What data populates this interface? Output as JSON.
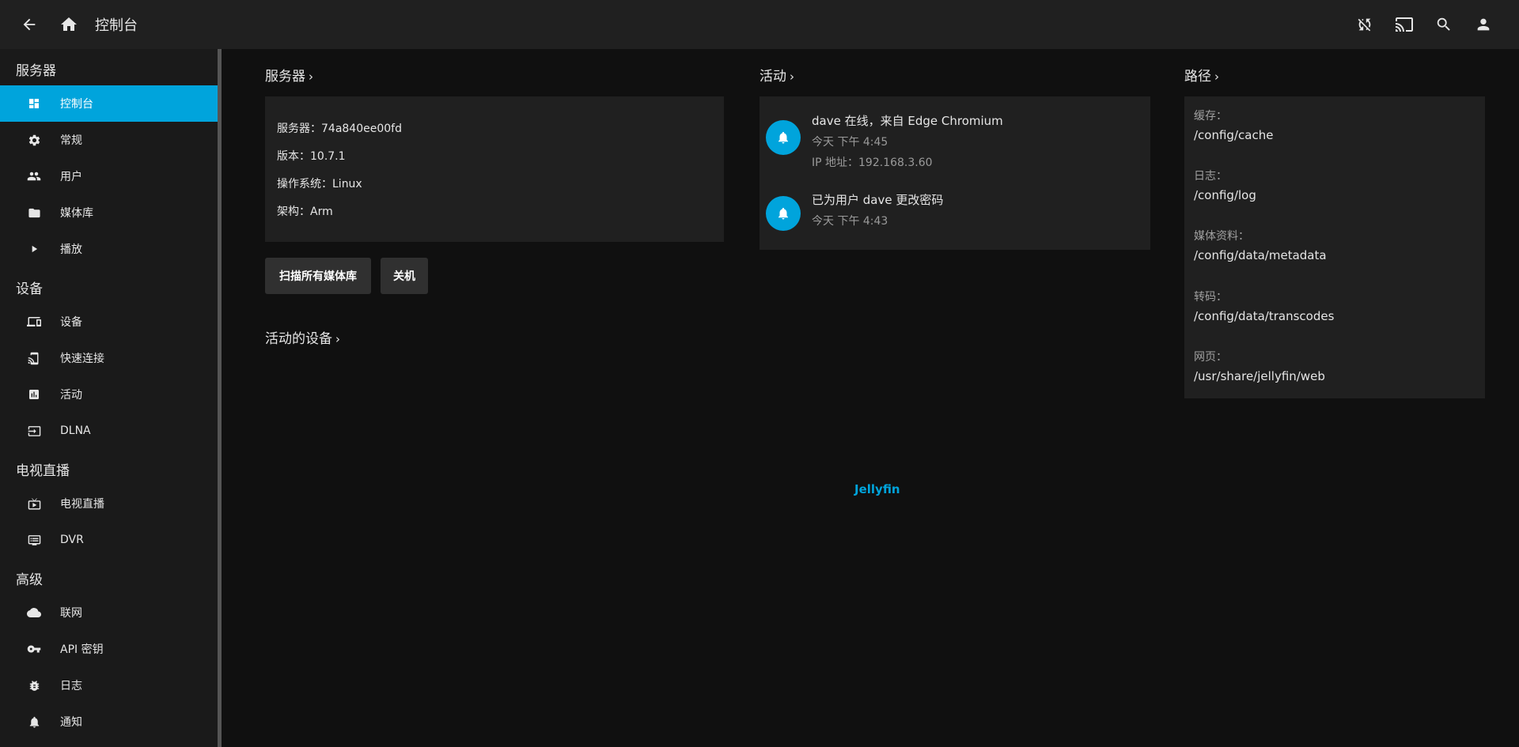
{
  "header": {
    "title": "控制台",
    "back_icon": "arrow-left-icon",
    "home_icon": "home-icon",
    "right_icons": [
      "sync-disabled-icon",
      "cast-icon",
      "search-icon",
      "user-icon"
    ]
  },
  "sidebar": {
    "sections": [
      {
        "title": "服务器",
        "items": [
          {
            "label": "控制台",
            "icon": "dashboard-icon",
            "active": true
          },
          {
            "label": "常规",
            "icon": "gear-icon"
          },
          {
            "label": "用户",
            "icon": "users-icon"
          },
          {
            "label": "媒体库",
            "icon": "folder-icon"
          },
          {
            "label": "播放",
            "icon": "play-icon"
          }
        ]
      },
      {
        "title": "设备",
        "items": [
          {
            "label": "设备",
            "icon": "devices-icon"
          },
          {
            "label": "快速连接",
            "icon": "cast-connect-icon"
          },
          {
            "label": "活动",
            "icon": "chart-icon"
          },
          {
            "label": "DLNA",
            "icon": "input-icon"
          }
        ]
      },
      {
        "title": "电视直播",
        "items": [
          {
            "label": "电视直播",
            "icon": "live-tv-icon"
          },
          {
            "label": "DVR",
            "icon": "dvr-icon"
          }
        ]
      },
      {
        "title": "高级",
        "items": [
          {
            "label": "联网",
            "icon": "cloud-icon"
          },
          {
            "label": "API 密钥",
            "icon": "key-icon"
          },
          {
            "label": "日志",
            "icon": "bug-icon"
          },
          {
            "label": "通知",
            "icon": "bell-icon"
          }
        ]
      }
    ]
  },
  "server": {
    "title": "服务器",
    "lines": [
      "服务器：74a840ee00fd",
      "版本：10.7.1",
      "操作系统：Linux",
      "架构：Arm"
    ],
    "scan_button": "扫描所有媒体库",
    "shutdown_button": "关机"
  },
  "active_devices": {
    "title": "活动的设备"
  },
  "activity": {
    "title": "活动",
    "items": [
      {
        "name": "dave 在线，来自 Edge Chromium",
        "sub1": "今天 下午 4:45",
        "sub2": "IP 地址：192.168.3.60"
      },
      {
        "name": "已为用户 dave 更改密码",
        "sub1": "今天 下午 4:43"
      }
    ]
  },
  "paths": {
    "title": "路径",
    "items": [
      {
        "label": "缓存：",
        "value": "/config/cache"
      },
      {
        "label": "日志：",
        "value": "/config/log"
      },
      {
        "label": "媒体资料：",
        "value": "/config/data/metadata"
      },
      {
        "label": "转码：",
        "value": "/config/data/transcodes"
      },
      {
        "label": "网页：",
        "value": "/usr/share/jellyfin/web"
      }
    ]
  },
  "footer": {
    "brand": "Jellyfin"
  },
  "colors": {
    "accent": "#00a4dc",
    "background": "#101010",
    "card": "#202020",
    "header": "#202020"
  }
}
